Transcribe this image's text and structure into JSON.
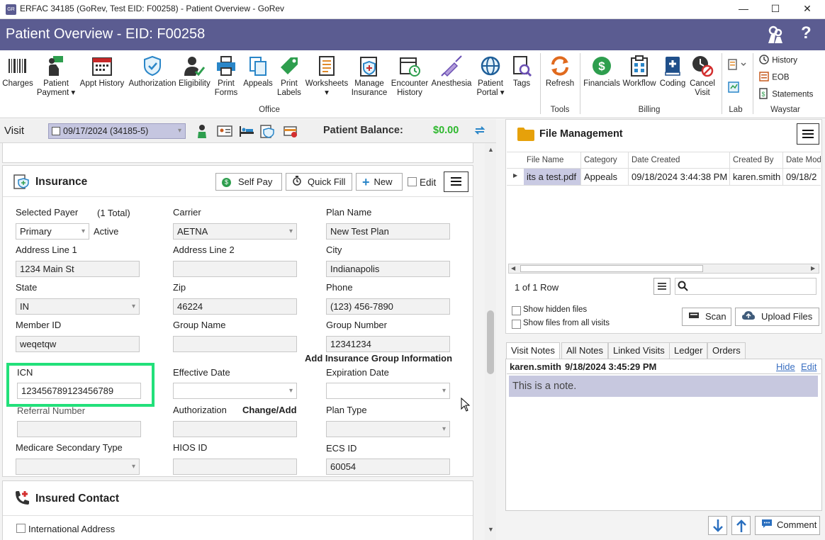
{
  "window": {
    "title": "ERFAC 34185 (GoRev, Test EID: F00258) - Patient Overview - GoRev",
    "app_icon_text": "GR"
  },
  "header": {
    "title": "Patient Overview - EID: F00258"
  },
  "ribbon": {
    "office_items": [
      {
        "label": "Charges",
        "icon": "barcode-icon"
      },
      {
        "label": "Patient Payment ▾",
        "icon": "payment-icon"
      },
      {
        "label": "Appt History",
        "icon": "calendar-icon"
      },
      {
        "label": "Authorization",
        "icon": "shield-icon"
      },
      {
        "label": "Eligibility",
        "icon": "user-check-icon"
      },
      {
        "label": "Print Forms",
        "icon": "printer-icon"
      },
      {
        "label": "Appeals",
        "icon": "documents-icon"
      },
      {
        "label": "Print Labels",
        "icon": "label-icon"
      },
      {
        "label": "Worksheets ▾",
        "icon": "worksheet-icon"
      },
      {
        "label": "Manage Insurance",
        "icon": "insurance-icon"
      },
      {
        "label": "Encounter History",
        "icon": "encounter-icon"
      },
      {
        "label": "Anesthesia",
        "icon": "syringe-icon"
      },
      {
        "label": "Patient Portal ▾",
        "icon": "globe-icon"
      },
      {
        "label": "Tags",
        "icon": "tags-icon"
      }
    ],
    "office_group": "Office",
    "tools_items": [
      {
        "label": "Refresh",
        "icon": "refresh-icon"
      }
    ],
    "tools_group": "Tools",
    "billing_items": [
      {
        "label": "Financials",
        "icon": "dollar-icon"
      },
      {
        "label": "Workflow",
        "icon": "workflow-icon"
      },
      {
        "label": "Coding",
        "icon": "coding-icon"
      },
      {
        "label": "Cancel Visit",
        "icon": "cancel-clock-icon"
      }
    ],
    "billing_group": "Billing",
    "lab_group": "Lab",
    "waystar_items": [
      "History",
      "EOB",
      "Statements"
    ],
    "waystar_group": "Waystar"
  },
  "visit": {
    "label": "Visit",
    "selected": "09/17/2024 (34185-5)",
    "balance_label": "Patient Balance:",
    "balance_value": "$0.00"
  },
  "insurance": {
    "title": "Insurance",
    "buttons": {
      "self_pay": "Self Pay",
      "quick_fill": "Quick Fill",
      "new": "New",
      "edit": "Edit"
    },
    "selected_payer_label": "Selected Payer",
    "total": "(1 Total)",
    "payer_value": "Primary",
    "active": "Active",
    "carrier_label": "Carrier",
    "carrier_value": "AETNA",
    "plan_name_label": "Plan Name",
    "plan_name_value": "New Test Plan",
    "address1_label": "Address Line 1",
    "address1_value": "1234 Main St",
    "address2_label": "Address Line 2",
    "address2_value": "",
    "city_label": "City",
    "city_value": "Indianapolis",
    "state_label": "State",
    "state_value": "IN",
    "zip_label": "Zip",
    "zip_value": "46224",
    "phone_label": "Phone",
    "phone_value": "(123) 456-7890",
    "member_id_label": "Member ID",
    "member_id_value": "weqetqw",
    "group_name_label": "Group Name",
    "group_name_value": "",
    "group_number_label": "Group Number",
    "group_number_value": "12341234",
    "add_group_info": "Add Insurance Group Information",
    "icn_label": "ICN",
    "icn_value": "123456789123456789",
    "effective_date_label": "Effective Date",
    "expiration_date_label": "Expiration Date",
    "referral_label": "Referral Number",
    "authorization_label": "Authorization",
    "change_add": "Change/Add",
    "plan_type_label": "Plan Type",
    "medicare_label": "Medicare Secondary Type",
    "hios_label": "HIOS ID",
    "ecs_label": "ECS ID",
    "ecs_value": "60054"
  },
  "insured_contact": {
    "title": "Insured Contact",
    "international": "International Address"
  },
  "file_management": {
    "title": "File Management",
    "columns": [
      "File Name",
      "Category",
      "Date Created",
      "Created By",
      "Date Mod"
    ],
    "rows": [
      [
        "its a test.pdf",
        "Appeals",
        "09/18/2024 3:44:38 PM",
        "karen.smith",
        "09/18/2"
      ]
    ],
    "row_count": "1 of 1 Row",
    "show_hidden": "Show hidden files",
    "show_all_visits": "Show files from all visits",
    "scan": "Scan",
    "upload": "Upload Files"
  },
  "notes": {
    "tabs": [
      "Visit Notes",
      "All Notes",
      "Linked Visits",
      "Ledger",
      "Orders"
    ],
    "author": "karen.smith",
    "timestamp": "9/18/2024 3:45:29 PM",
    "hide": "Hide",
    "edit": "Edit",
    "text": "This is a note.",
    "comment": "Comment"
  },
  "colors": {
    "header": "#5b5c91",
    "highlight": "#22e07a",
    "balance": "#2eb82e",
    "note_bg": "#c7c8df"
  }
}
